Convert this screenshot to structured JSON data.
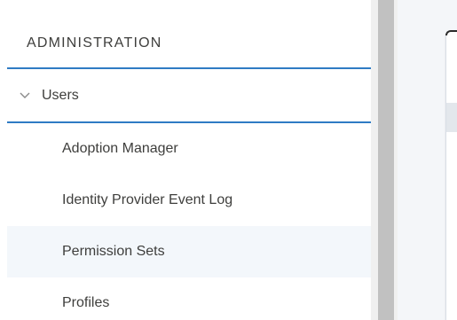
{
  "sidebar": {
    "section_title": "ADMINISTRATION",
    "group": {
      "label": "Users",
      "icon": "chevron-down-icon",
      "expanded": true
    },
    "items": [
      {
        "label": "Adoption Manager",
        "selected": false
      },
      {
        "label": "Identity Provider Event Log",
        "selected": false
      },
      {
        "label": "Permission Sets",
        "selected": true
      },
      {
        "label": "Profiles",
        "selected": false
      }
    ]
  },
  "colors": {
    "accent_divider": "#2f7bc4",
    "selected_row_bg": "#f3f7fb",
    "text": "#3e3e3c"
  }
}
